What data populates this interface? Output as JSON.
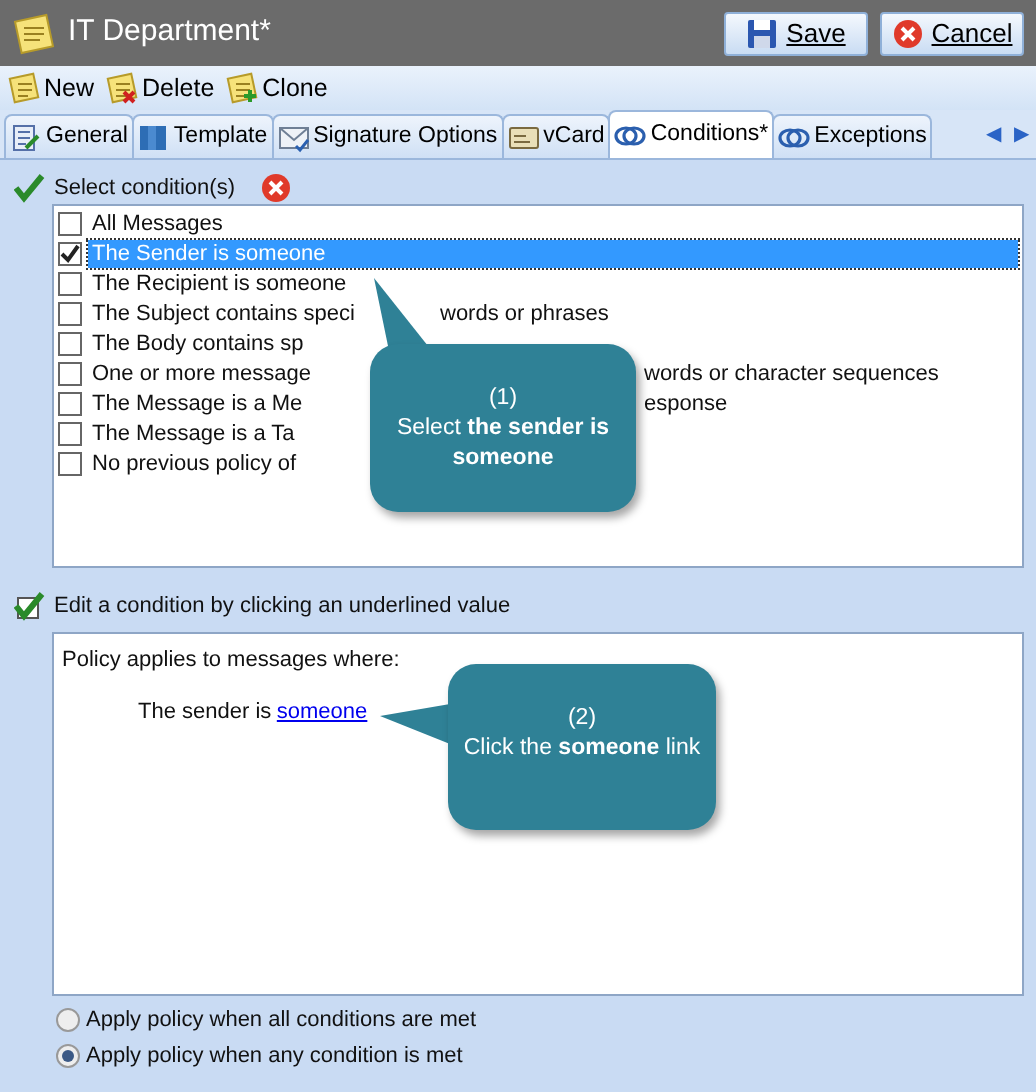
{
  "window": {
    "title": "IT Department*"
  },
  "header_buttons": [
    {
      "kind": "save",
      "label": "Save"
    },
    {
      "kind": "cancel",
      "label": "Cancel"
    }
  ],
  "toolbar": [
    {
      "kind": "new",
      "label": "New"
    },
    {
      "kind": "delete",
      "label": "Delete"
    },
    {
      "kind": "clone",
      "label": "Clone"
    }
  ],
  "tabs": [
    {
      "kind": "general",
      "label": "General",
      "selected": false
    },
    {
      "kind": "template",
      "label": "Template",
      "selected": false
    },
    {
      "kind": "signature",
      "label": "Signature Options",
      "selected": false
    },
    {
      "kind": "vcard",
      "label": "vCard",
      "selected": false
    },
    {
      "kind": "rings",
      "label": "Conditions*",
      "selected": true
    },
    {
      "kind": "rings",
      "label": "Exceptions",
      "selected": false
    }
  ],
  "tab_scroll": [
    "◀",
    "▶"
  ],
  "conditions_header": {
    "label": "Select condition(s)"
  },
  "conditions": [
    {
      "text": "All Messages",
      "checked": false,
      "selected": false
    },
    {
      "text": "The Sender is someone",
      "checked": true,
      "selected": true
    },
    {
      "text": "The Recipient is someone",
      "checked": false,
      "selected": false
    },
    {
      "text": "The Subject contains speci",
      "text_after": "words or phrases",
      "checked": false,
      "selected": false
    },
    {
      "text": "The Body contains sp",
      "checked": false,
      "selected": false
    },
    {
      "text": "One or more message",
      "text_after": "words or character sequences",
      "checked": false,
      "selected": false
    },
    {
      "text": "The Message is a Me",
      "text_after": "esponse",
      "checked": false,
      "selected": false
    },
    {
      "text": "The Message is a Ta",
      "checked": false,
      "selected": false
    },
    {
      "text": "No previous policy of",
      "checked": false,
      "selected": false
    }
  ],
  "edit_header": {
    "label": "Edit a condition by clicking an underlined value"
  },
  "description": {
    "intro": "Policy applies to messages where:",
    "clause": "The sender is",
    "link": "someone"
  },
  "apply_options": [
    {
      "label": "Apply policy when all conditions are met",
      "selected": false
    },
    {
      "label": "Apply policy when any condition is met",
      "selected": true
    }
  ],
  "callouts": [
    {
      "step": "(1)",
      "text": "Select **the sender is someone**"
    },
    {
      "step": "(2)",
      "text": "Click the **someone** link"
    }
  ]
}
